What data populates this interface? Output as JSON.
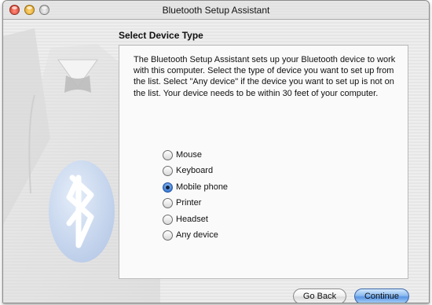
{
  "window": {
    "title": "Bluetooth Setup Assistant"
  },
  "page": {
    "heading": "Select Device Type",
    "description": "The Bluetooth Setup Assistant sets up your Bluetooth device to work with this computer. Select the type of device you want to set up from the list. Select \"Any device\" if the device you want to set up is not on the list. Your device needs to be within 30 feet of your computer."
  },
  "device_types": [
    {
      "label": "Mouse",
      "checked": false
    },
    {
      "label": "Keyboard",
      "checked": false
    },
    {
      "label": "Mobile phone",
      "checked": true
    },
    {
      "label": "Printer",
      "checked": false
    },
    {
      "label": "Headset",
      "checked": false
    },
    {
      "label": "Any device",
      "checked": false
    }
  ],
  "buttons": {
    "back": "Go Back",
    "continue": "Continue"
  },
  "colors": {
    "accent": "#5a96e4"
  },
  "icons": [
    "close-icon",
    "minimize-icon",
    "zoom-icon",
    "tuxedo-illustration",
    "bluetooth-icon",
    "radio-button"
  ]
}
